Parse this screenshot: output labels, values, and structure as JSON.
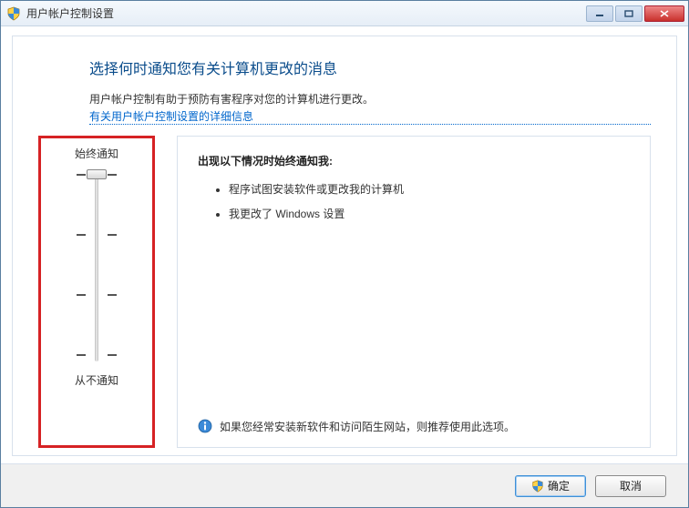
{
  "window": {
    "title": "用户帐户控制设置"
  },
  "heading": "选择何时通知您有关计算机更改的消息",
  "subtext": "用户帐户控制有助于预防有害程序对您的计算机进行更改。",
  "link": "有关用户帐户控制设置的详细信息",
  "slider": {
    "top_label": "始终通知",
    "bottom_label": "从不通知"
  },
  "description": {
    "title": "出现以下情况时始终通知我:",
    "items": [
      "程序试图安装软件或更改我的计算机",
      "我更改了 Windows 设置"
    ],
    "recommendation": "如果您经常安装新软件和访问陌生网站，则推荐使用此选项。"
  },
  "buttons": {
    "ok": "确定",
    "cancel": "取消"
  }
}
